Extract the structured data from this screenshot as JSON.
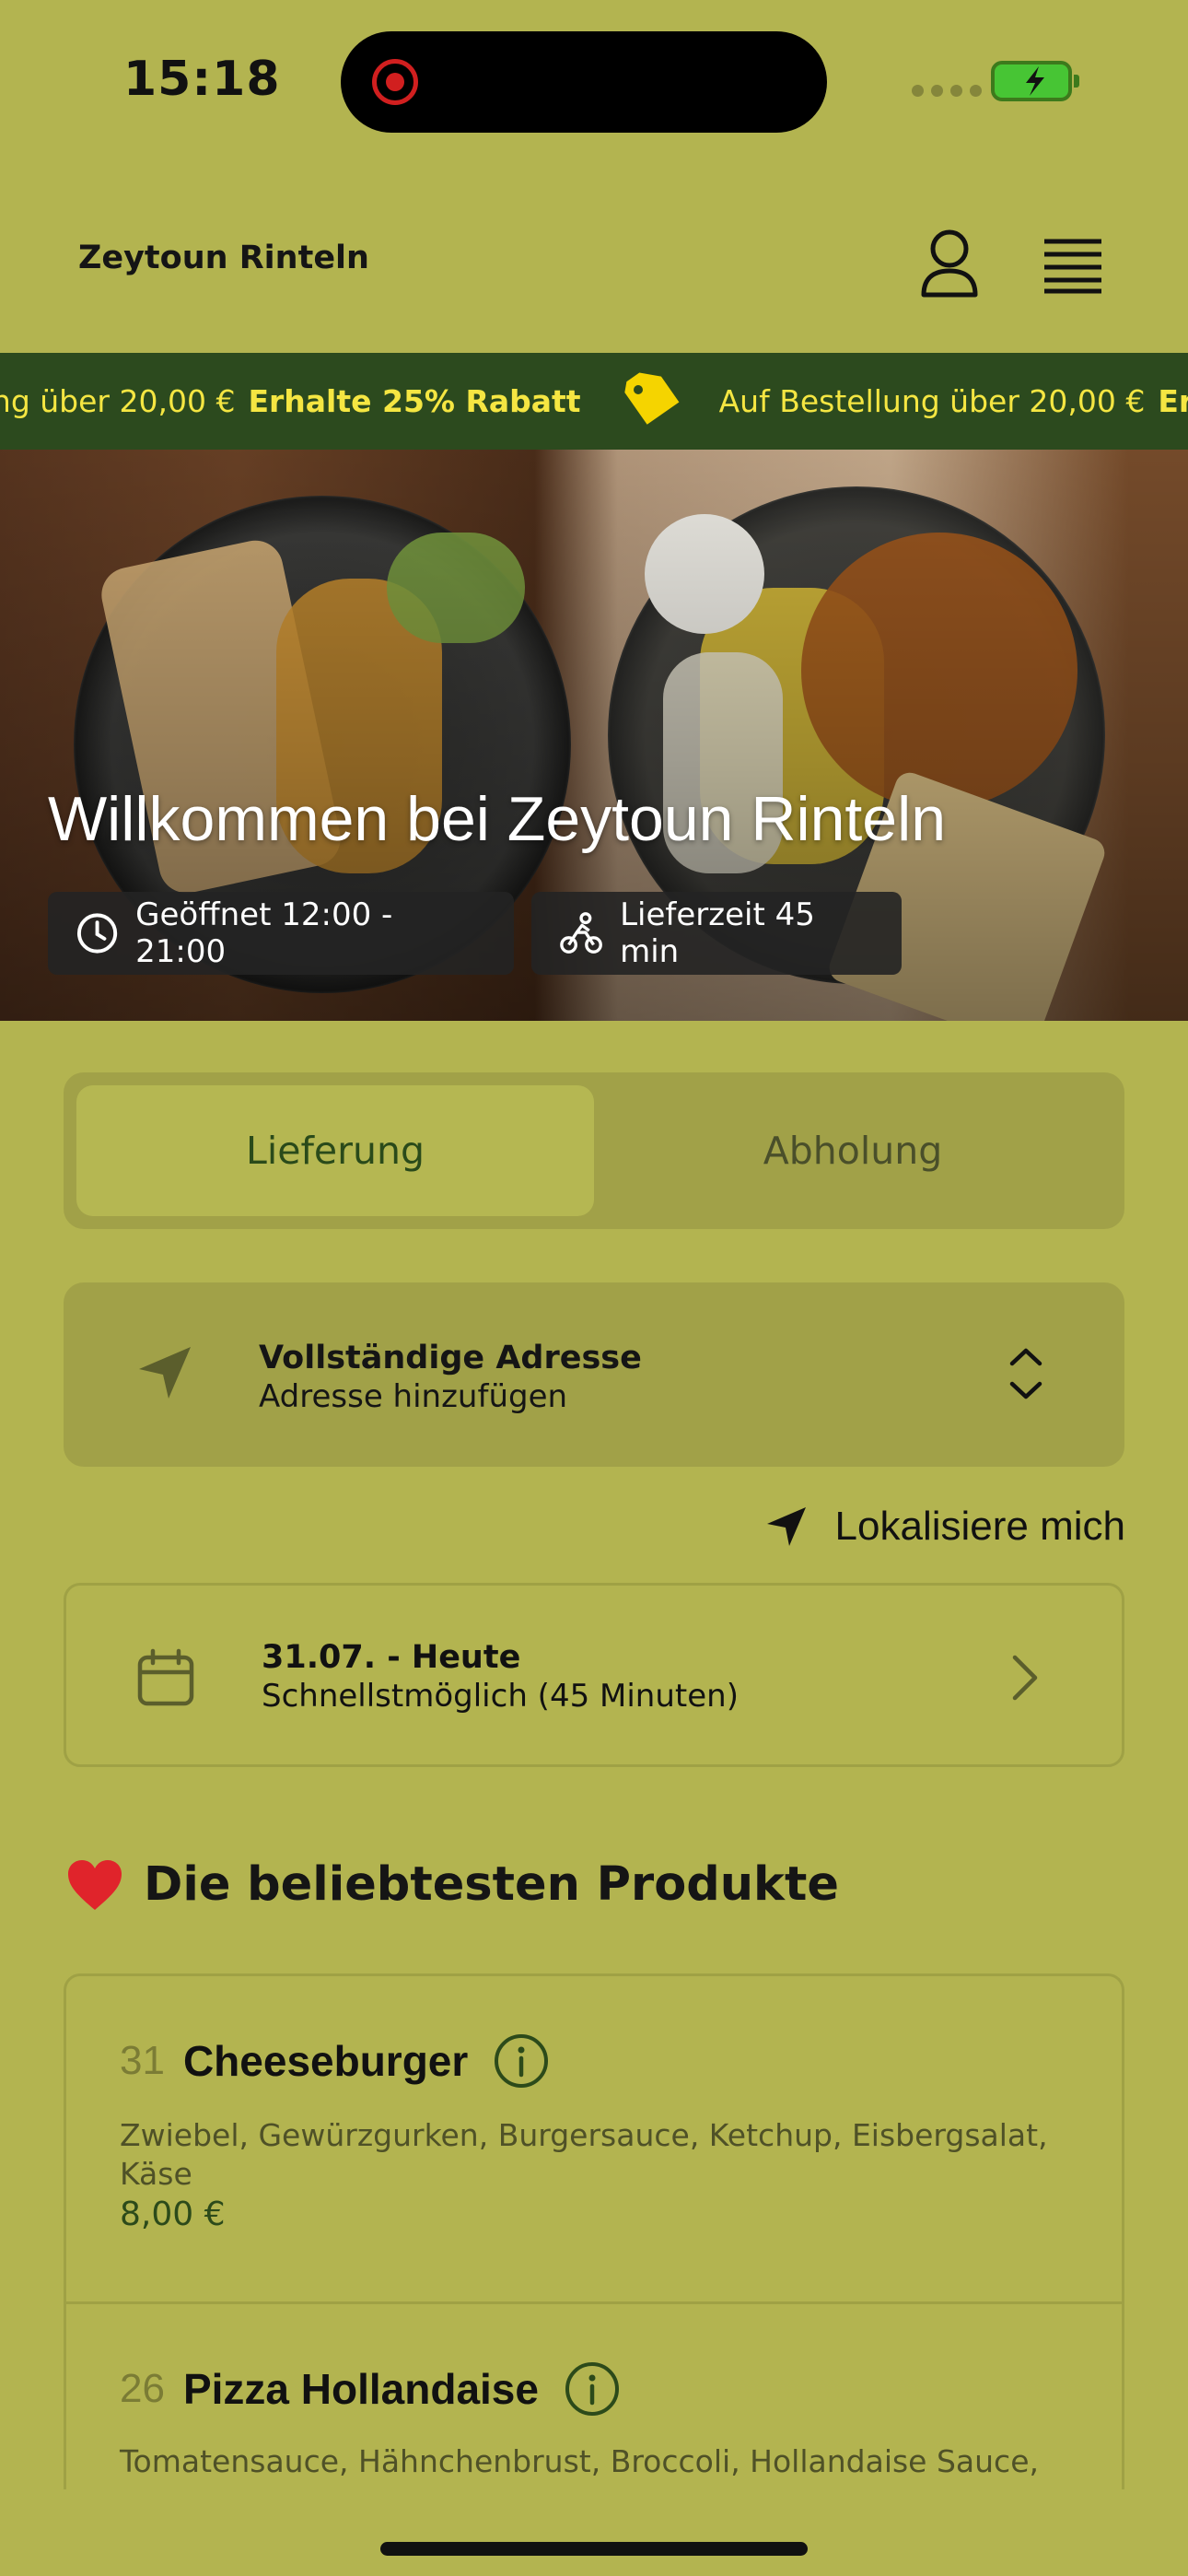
{
  "status_bar": {
    "time": "15:18"
  },
  "header": {
    "title": "Zeytoun Rinteln"
  },
  "promo": {
    "items": [
      {
        "text": "ung über 20,00 €",
        "highlight": "Erhalte 25% Rabatt"
      },
      {
        "text": "Auf Bestellung über 20,00 €",
        "highlight": "Er"
      }
    ]
  },
  "hero": {
    "title": "Willkommen bei Zeytoun Rinteln",
    "open_hours": "Geöffnet 12:00 - 21:00",
    "delivery_time": "Lieferzeit 45 min"
  },
  "order_mode": {
    "tabs": [
      {
        "label": "Lieferung",
        "active": true
      },
      {
        "label": "Abholung",
        "active": false
      }
    ]
  },
  "address": {
    "title": "Vollständige Adresse",
    "subtitle": "Adresse hinzufügen"
  },
  "locate": {
    "label": "Lokalisiere mich"
  },
  "schedule": {
    "title": "31.07. - Heute",
    "subtitle": "Schnellstmöglich (45 Minuten)"
  },
  "popular": {
    "heading": "Die beliebtesten Produkte",
    "products": [
      {
        "number": "31",
        "name": "Cheeseburger",
        "description": "Zwiebel, Gewürzgurken, Burgersauce, Ketchup, Eisbergsalat, Käse",
        "price": "8,00 €"
      },
      {
        "number": "26",
        "name": "Pizza Hollandaise",
        "description": "Tomatensauce, Hähnchenbrust, Broccoli, Hollandaise Sauce,"
      }
    ]
  },
  "colors": {
    "background": "#b3b450",
    "banner": "#2c4a1e",
    "banner_text": "#f5e642",
    "card": "#a1a148"
  }
}
